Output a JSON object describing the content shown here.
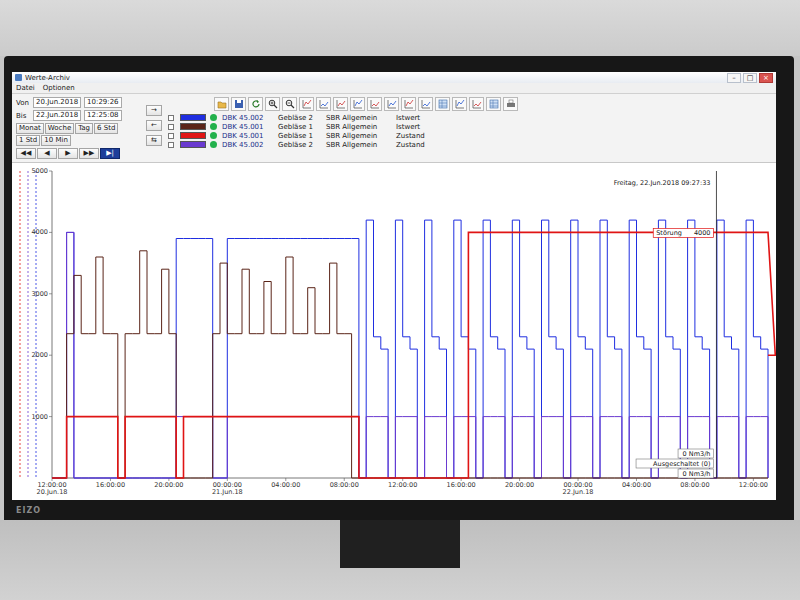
{
  "monitor": {
    "brand": "EIZO"
  },
  "window": {
    "title": "Werte-Archiv",
    "controls": [
      "–",
      "□",
      "×"
    ]
  },
  "menu": [
    "Datei",
    "Optionen"
  ],
  "range": {
    "from": {
      "label": "Von",
      "date": "20.Jun.2018",
      "time": "10:29:26"
    },
    "to": {
      "label": "Bis",
      "date": "22.Jun.2018",
      "time": "12:25:08"
    }
  },
  "spans": [
    {
      "label": "Monat",
      "selected": false
    },
    {
      "label": "Woche",
      "selected": false
    },
    {
      "label": "Tag",
      "selected": false
    },
    {
      "label": "6 Std",
      "selected": false
    },
    {
      "label": "1 Std",
      "selected": false
    },
    {
      "label": "10 Min",
      "selected": false
    }
  ],
  "nav": [
    {
      "label": "◀◀",
      "selected": false
    },
    {
      "label": "◀",
      "selected": false
    },
    {
      "label": "▶",
      "selected": false
    },
    {
      "label": "▶▶",
      "selected": false
    },
    {
      "label": "▶|",
      "selected": true
    }
  ],
  "side_buttons": [
    "→",
    "←",
    "⇆"
  ],
  "series": [
    {
      "checked": false,
      "color": "#1f2ee0",
      "online": true,
      "id": "DBK 45.002",
      "device": "Gebläse 2",
      "group": "SBR Allgemein",
      "signal": "Istwert",
      "values": [
        0,
        0,
        4000,
        0,
        0,
        0,
        0,
        0,
        0,
        0,
        0,
        0,
        0,
        0,
        0,
        0,
        0,
        3900,
        3900,
        3900,
        3900,
        3900,
        0,
        0,
        3900,
        3900,
        3900,
        3900,
        3900,
        3900,
        3900,
        3900,
        3900,
        3900,
        3900,
        3900,
        3900,
        3900,
        3900,
        3900,
        3900,
        3900,
        0,
        4200,
        2300,
        2100,
        0,
        4200,
        2300,
        2100,
        0,
        4200,
        2300,
        2100,
        0,
        4200,
        2300,
        2100,
        0,
        4200,
        2300,
        2100,
        0,
        4200,
        2300,
        2100,
        0,
        4200,
        2300,
        2100,
        0,
        4200,
        2300,
        2100,
        0,
        4200,
        2300,
        2100,
        0,
        4200,
        2300,
        2100,
        0,
        4200,
        2300,
        2100,
        0,
        4200,
        2300,
        2100,
        0,
        4200,
        2300,
        2100,
        0,
        4200,
        2300,
        2100,
        0
      ]
    },
    {
      "checked": false,
      "color": "#5a2418",
      "online": true,
      "id": "DBK 45.001",
      "device": "Gebläse 1",
      "group": "SBR Allgemein",
      "signal": "Istwert",
      "values": [
        0,
        0,
        2350,
        3300,
        2350,
        2350,
        3600,
        2350,
        2350,
        0,
        2350,
        2350,
        3700,
        2350,
        2350,
        3400,
        2350,
        0,
        0,
        0,
        0,
        0,
        2350,
        3500,
        2350,
        2350,
        3400,
        2350,
        2350,
        3200,
        2350,
        2350,
        3600,
        2350,
        2350,
        3100,
        2350,
        2350,
        3500,
        2350,
        2350,
        0,
        0,
        0,
        0,
        0,
        0,
        0,
        0,
        0,
        0,
        0,
        0,
        0,
        0,
        0,
        0,
        0,
        0,
        0,
        0,
        0,
        0,
        0,
        0,
        0,
        0,
        0,
        0,
        0,
        0,
        0,
        0,
        0,
        0,
        0,
        0,
        0,
        0,
        0,
        0,
        0,
        0,
        0,
        0,
        0,
        0,
        0,
        0,
        0,
        0,
        0,
        0,
        0,
        0,
        0,
        0,
        0,
        0
      ]
    },
    {
      "checked": false,
      "color": "#e01414",
      "online": true,
      "id": "DBK 45.001",
      "device": "Gebläse 1",
      "group": "SBR Allgemein",
      "signal": "Zustand",
      "values": [
        0,
        0,
        1000,
        1000,
        1000,
        1000,
        1000,
        1000,
        1000,
        0,
        1000,
        1000,
        1000,
        1000,
        1000,
        1000,
        1000,
        0,
        1000,
        1000,
        1000,
        1000,
        1000,
        1000,
        1000,
        1000,
        1000,
        1000,
        1000,
        1000,
        1000,
        1000,
        1000,
        1000,
        1000,
        1000,
        1000,
        1000,
        1000,
        1000,
        1000,
        1000,
        0,
        0,
        0,
        0,
        0,
        0,
        0,
        0,
        0,
        0,
        0,
        0,
        0,
        0,
        0,
        4000,
        4000,
        4000,
        4000,
        4000,
        4000,
        4000,
        4000,
        4000,
        4000,
        4000,
        4000,
        4000,
        4000,
        4000,
        4000,
        4000,
        4000,
        4000,
        4000,
        4000,
        4000,
        4000,
        4000,
        4000,
        4000,
        4000,
        4000,
        4000,
        4000,
        4000,
        4000,
        4000,
        4000,
        4000,
        4000,
        4000,
        4000,
        4000,
        4000,
        4000,
        4000,
        2000
      ]
    },
    {
      "checked": false,
      "color": "#6a3ad0",
      "online": true,
      "id": "DBK 45.002",
      "device": "Gebläse 2",
      "group": "SBR Allgemein",
      "signal": "Zustand",
      "values": [
        0,
        0,
        4000,
        0,
        0,
        0,
        0,
        0,
        0,
        0,
        0,
        0,
        0,
        0,
        0,
        0,
        0,
        1000,
        1000,
        1000,
        1000,
        1000,
        0,
        0,
        1000,
        1000,
        1000,
        1000,
        1000,
        1000,
        1000,
        1000,
        1000,
        1000,
        1000,
        1000,
        1000,
        1000,
        1000,
        1000,
        1000,
        1000,
        0,
        1000,
        1000,
        1000,
        0,
        1000,
        1000,
        1000,
        0,
        1000,
        1000,
        1000,
        0,
        1000,
        1000,
        1000,
        0,
        1000,
        1000,
        1000,
        0,
        1000,
        1000,
        1000,
        0,
        1000,
        1000,
        1000,
        0,
        1000,
        1000,
        1000,
        0,
        1000,
        1000,
        1000,
        0,
        1000,
        1000,
        1000,
        0,
        1000,
        1000,
        1000,
        0,
        1000,
        1000,
        1000,
        0,
        1000,
        1000,
        1000,
        0,
        1000,
        1000,
        1000,
        0
      ]
    }
  ],
  "axis": {
    "y_ticks": [
      "1000",
      "2000",
      "3000",
      "4000",
      "5000"
    ],
    "x_ticks": [
      {
        "time": "12:00:00",
        "date": "20.Jun.18"
      },
      {
        "time": "16:00:00",
        "date": ""
      },
      {
        "time": "20:00:00",
        "date": ""
      },
      {
        "time": "00:00:00",
        "date": "21.Jun.18"
      },
      {
        "time": "04:00:00",
        "date": ""
      },
      {
        "time": "08:00:00",
        "date": ""
      },
      {
        "time": "12:00:00",
        "date": ""
      },
      {
        "time": "16:00:00",
        "date": ""
      },
      {
        "time": "20:00:00",
        "date": ""
      },
      {
        "time": "00:00:00",
        "date": "22.Jun.18"
      },
      {
        "time": "04:00:00",
        "date": ""
      },
      {
        "time": "08:00:00",
        "date": ""
      },
      {
        "time": "12:00:00",
        "date": ""
      }
    ]
  },
  "cursor": {
    "title": "Freitag, 22.Jun.2018 09:27:33",
    "level": 0.928,
    "fault": {
      "text": "Störung",
      "value": "4000"
    },
    "labels": [
      "0 Nm3/h",
      "Ausgeschaltet (0)",
      "0 Nm3/h"
    ]
  }
}
